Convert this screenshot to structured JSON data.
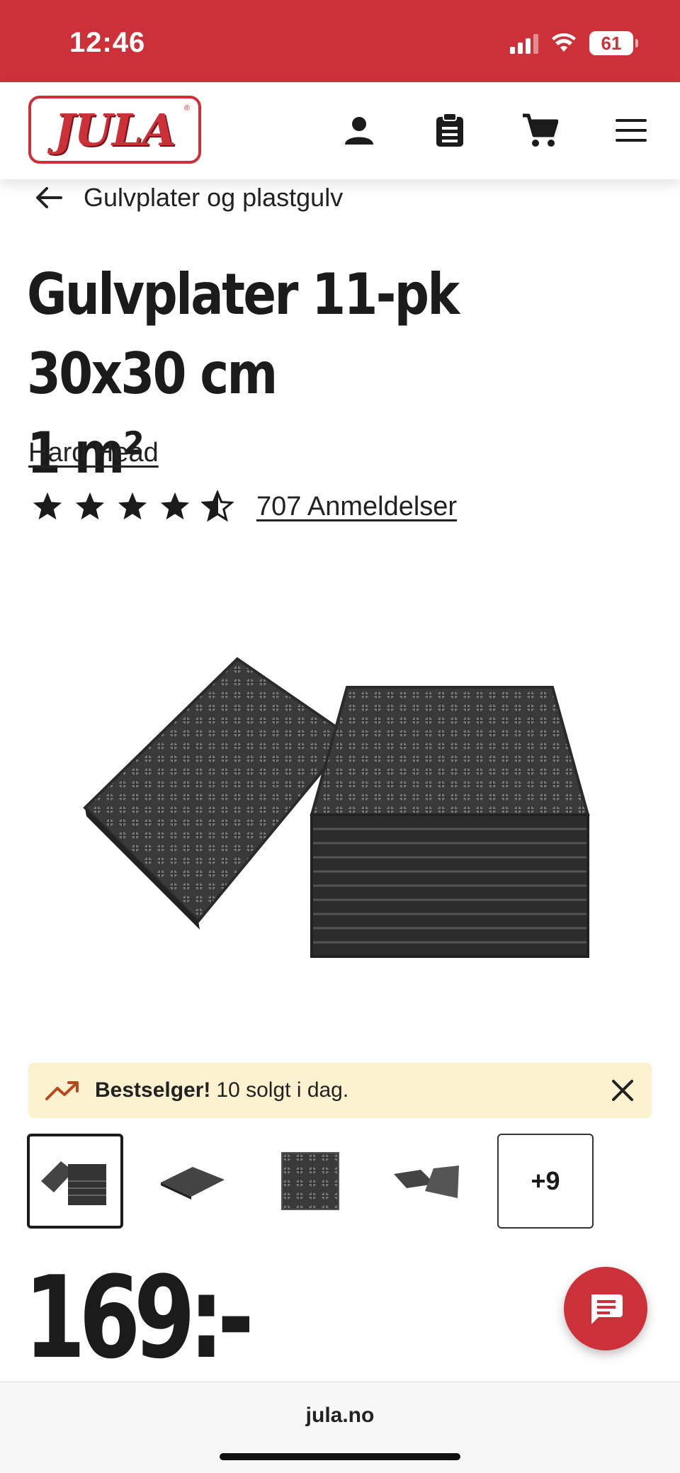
{
  "status_bar": {
    "time": "12:46",
    "battery": "61",
    "background": "#cc3139"
  },
  "header": {
    "logo_text": "JULA",
    "logo_mark": "®",
    "icons": [
      "user-icon",
      "clipboard-icon",
      "cart-icon",
      "menu-icon"
    ]
  },
  "breadcrumb": {
    "label": "Gulvplater og plastgulv"
  },
  "product": {
    "title_line1": "Gulvplater 11-pk 30x30 cm",
    "title_line2": "1 m²",
    "brand": "Hard Head",
    "rating": 4.5,
    "reviews": "707 Anmeldelser",
    "price": "169:-"
  },
  "bestseller": {
    "bold": "Bestselger!",
    "text": "10 solgt i dag.",
    "background": "#fdf2d0"
  },
  "thumbnails": {
    "more_label": "+9"
  },
  "browser": {
    "url": "jula.no"
  },
  "colors": {
    "brand_red": "#cc3139",
    "text": "#1b1b1b"
  }
}
